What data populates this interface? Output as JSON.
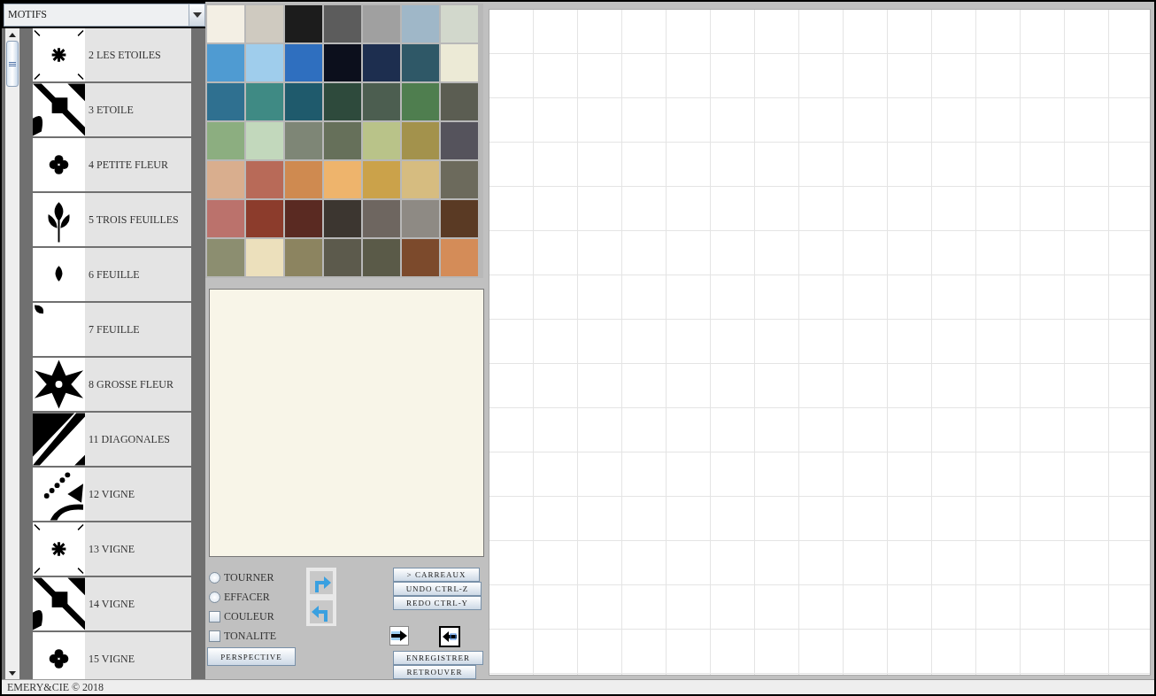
{
  "dropdown": {
    "value": "MOTIFS"
  },
  "motifs": [
    {
      "label": "2 LES ETOILES"
    },
    {
      "label": "3 ETOILE"
    },
    {
      "label": "4 PETITE FLEUR"
    },
    {
      "label": "5 TROIS FEUILLES"
    },
    {
      "label": "6 FEUILLE"
    },
    {
      "label": "7 FEUILLE"
    },
    {
      "label": "8 GROSSE FLEUR"
    },
    {
      "label": "11 DIAGONALES"
    },
    {
      "label": "12 VIGNE"
    },
    {
      "label": "13 VIGNE"
    },
    {
      "label": "14 VIGNE"
    },
    {
      "label": "15 VIGNE"
    }
  ],
  "palette": [
    {
      "color": "#f3efe4"
    },
    {
      "color": "#cfcac0"
    },
    {
      "color": "#1c1c1c"
    },
    {
      "color": "#5c5c5c"
    },
    {
      "color": "#a0a0a0"
    },
    {
      "color": "#9fb7c8"
    },
    {
      "color": "#d2d8cc"
    },
    {
      "color": "#4f9bd2"
    },
    {
      "color": "#9fcdec"
    },
    {
      "color": "#2f6fbf"
    },
    {
      "color": "#0c0f1c"
    },
    {
      "color": "#1d2e4f"
    },
    {
      "color": "#2f5867"
    },
    {
      "color": "#ecead6"
    },
    {
      "color": "#2f7090"
    },
    {
      "color": "#3f8a84"
    },
    {
      "color": "#1f5a6c"
    },
    {
      "color": "#2e4a3c"
    },
    {
      "color": "#4c5e50"
    },
    {
      "color": "#4f7e4f"
    },
    {
      "color": "#5b5d52"
    },
    {
      "color": "#8cae80"
    },
    {
      "color": "#c2d8bc"
    },
    {
      "color": "#7e8676"
    },
    {
      "color": "#66705a"
    },
    {
      "color": "#b9c389"
    },
    {
      "color": "#a3924c"
    },
    {
      "color": "#55535c"
    },
    {
      "color": "#d9ae8e"
    },
    {
      "color": "#b86a58"
    },
    {
      "color": "#cf8a50"
    },
    {
      "color": "#eeb46c"
    },
    {
      "color": "#cba24a"
    },
    {
      "color": "#d6bc80"
    },
    {
      "color": "#6c6a5c"
    },
    {
      "color": "#bb726c"
    },
    {
      "color": "#8c3c2c"
    },
    {
      "color": "#5a2a22"
    },
    {
      "color": "#3c3630"
    },
    {
      "color": "#6e6660"
    },
    {
      "color": "#8e8a84"
    },
    {
      "color": "#5a3a24"
    },
    {
      "color": "#8c8e70"
    },
    {
      "color": "#ece0bc"
    },
    {
      "color": "#8c8460"
    },
    {
      "color": "#5c5a4c"
    },
    {
      "color": "#5a5a48"
    },
    {
      "color": "#7c4a2c"
    },
    {
      "color": "#d48c58"
    }
  ],
  "options": [
    {
      "kind": "radio",
      "label": "TOURNER",
      "selected": false
    },
    {
      "kind": "radio",
      "label": "EFFACER",
      "selected": false
    },
    {
      "kind": "checkbox",
      "label": "COULEUR",
      "checked": false
    },
    {
      "kind": "checkbox",
      "label": "TONALITE",
      "checked": false
    }
  ],
  "perspective_button": "PERSPECTIVE",
  "action_buttons": [
    "> CARREAUX",
    "UNDO CTRL-Z",
    "REDO CTRL-Y"
  ],
  "file_buttons": [
    "ENREGISTRER",
    "RETROUVER"
  ],
  "status_bar": "EMERY&CIE © 2018"
}
